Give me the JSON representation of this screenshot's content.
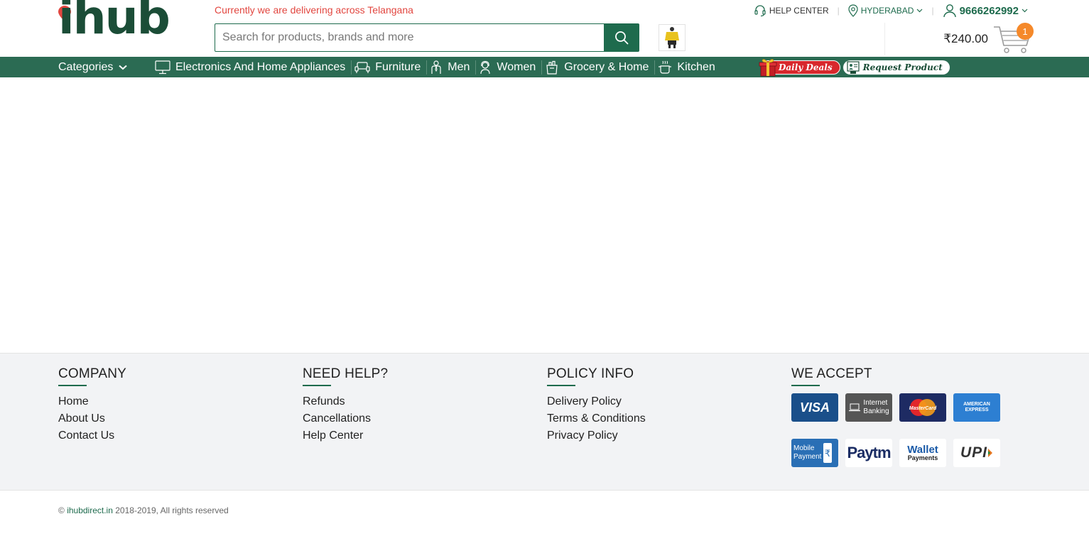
{
  "brand": {
    "logo_text": "ihub",
    "accent": "#1e6b4d",
    "logo_color": "#1b4d37",
    "pin_color": "#e2463f"
  },
  "header": {
    "delivery_note": "Currently we are delivering across Telangana",
    "search_placeholder": "Search for products, brands and more",
    "help_center": "HELP CENTER",
    "location": "HYDERABAD",
    "phone": "9666262992",
    "cart_total": "₹240.00",
    "cart_count": "1"
  },
  "nav": {
    "categories_label": "Categories",
    "items": [
      {
        "label": "Electronics And Home Appliances",
        "icon": "monitor-icon"
      },
      {
        "label": "Furniture",
        "icon": "sofa-icon"
      },
      {
        "label": "Men",
        "icon": "man-icon"
      },
      {
        "label": "Women",
        "icon": "woman-icon"
      },
      {
        "label": "Grocery & Home",
        "icon": "grocery-bag-icon"
      },
      {
        "label": "Kitchen",
        "icon": "cooking-pot-icon"
      }
    ],
    "daily_deals": "Daily Deals",
    "request_product": "Request Product"
  },
  "footer": {
    "company": {
      "title": "COMPANY",
      "links": [
        "Home",
        "About Us",
        "Contact Us"
      ]
    },
    "help": {
      "title": "NEED HELP?",
      "links": [
        "Refunds",
        "Cancellations",
        "Help Center"
      ]
    },
    "policy": {
      "title": "POLICY INFO",
      "links": [
        "Delivery Policy",
        "Terms & Conditions",
        "Privacy Policy"
      ]
    },
    "accept": {
      "title": "WE ACCEPT",
      "methods": {
        "visa": "VISA",
        "netbank_1": "Internet",
        "netbank_2": "Banking",
        "amex_1": "AMERICAN",
        "amex_2": "EXPRESS",
        "mastercard": "MasterCard",
        "mobile_1": "Mobile",
        "mobile_2": "Payment",
        "paytm": "Paytm",
        "wallet_1": "Wallet",
        "wallet_2": "Payments",
        "upi": "UPI"
      }
    }
  },
  "copyright": {
    "symbol": "©",
    "site": "ihubdirect.in",
    "rest": "2018-2019, All rights reserved"
  }
}
